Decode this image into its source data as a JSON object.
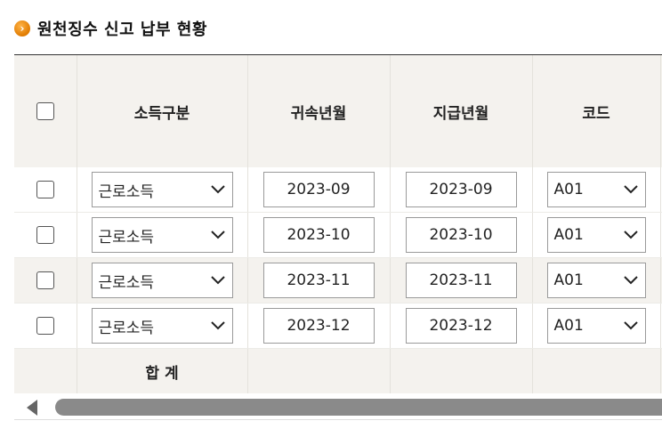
{
  "title": {
    "icon": "chevron-right-circle-icon",
    "text": "원천징수 신고 납부 현황"
  },
  "columns": {
    "checkbox": "",
    "income_type": "소득구분",
    "attr_month": "귀속년월",
    "pay_month": "지급년월",
    "code": "코드"
  },
  "rows": [
    {
      "income_type": "근로소득",
      "attr_month": "2023-09",
      "pay_month": "2023-09",
      "code": "A01"
    },
    {
      "income_type": "근로소득",
      "attr_month": "2023-10",
      "pay_month": "2023-10",
      "code": "A01"
    },
    {
      "income_type": "근로소득",
      "attr_month": "2023-11",
      "pay_month": "2023-11",
      "code": "A01"
    },
    {
      "income_type": "근로소득",
      "attr_month": "2023-12",
      "pay_month": "2023-12",
      "code": "A01"
    }
  ],
  "total": {
    "label": "합 계"
  },
  "colors": {
    "header_bg": "#f4f2ee",
    "title_icon": "#e07b00",
    "scroll_thumb": "#8a8a8a"
  }
}
